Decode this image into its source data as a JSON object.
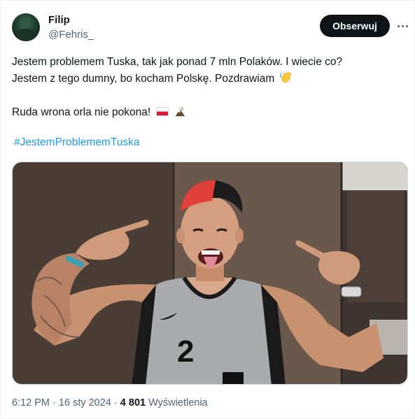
{
  "author": {
    "name": "Filip",
    "handle": "@Fehris_",
    "avatar_icon": "user-avatar"
  },
  "actions": {
    "follow_label": "Obserwuj",
    "more_icon": "more-horizontal-icon"
  },
  "tweet": {
    "line1": "Jestem problemem Tuska, tak jak ponad 7 mln Polaków. I wiecie co?",
    "line2": "Jestem z tego dumny, bo kocham Polskę. Pozdrawiam",
    "line3": "Ruda wrona orla nie pokona!",
    "emoji_wave": "waving-hand-icon",
    "emoji_flag": "poland-flag-icon",
    "emoji_eagle": "eagle-icon",
    "hashtag": "#JestemProblememTuska"
  },
  "media": {
    "jersey_number": "2",
    "description_icon": "photo"
  },
  "meta": {
    "time": "6:12 PM",
    "separator": "·",
    "date": "16 sty 2024",
    "views_count": "4 801",
    "views_label": "Wyświetlenia"
  },
  "colors": {
    "link": "#1d9bf0",
    "text_secondary": "#536471",
    "button_bg": "#0f1419"
  }
}
